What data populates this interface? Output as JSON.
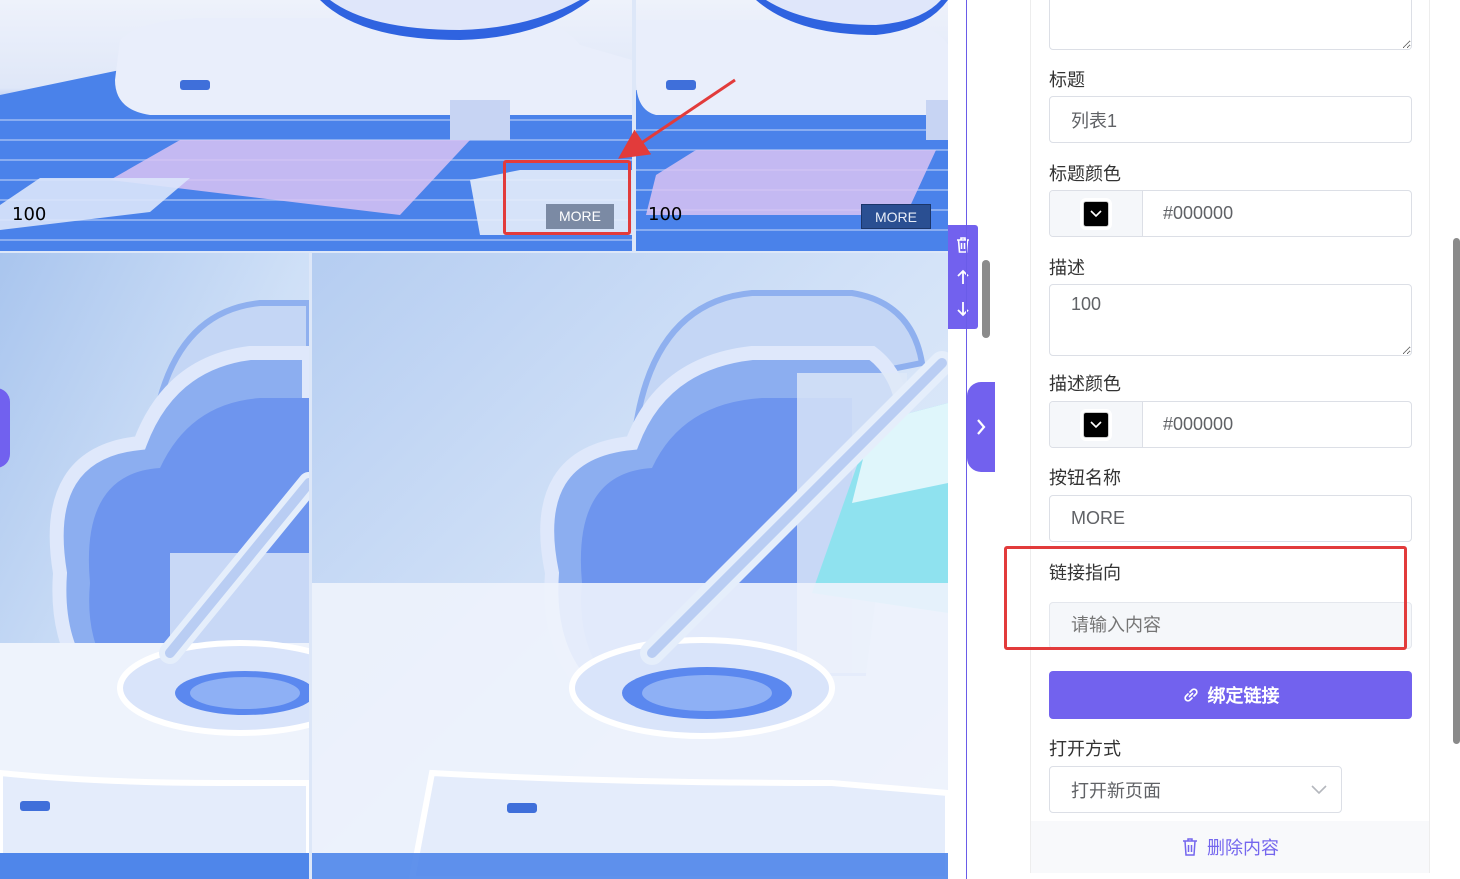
{
  "canvas": {
    "tiles": [
      {
        "desc": "100",
        "button": "MORE"
      },
      {
        "desc": "100",
        "button": "MORE"
      }
    ]
  },
  "toolbar": {
    "icons": [
      "trash-icon",
      "arrow-up-icon",
      "arrow-down-icon"
    ]
  },
  "panel": {
    "title_label": "标题",
    "title_value": "列表1",
    "title_color_label": "标题颜色",
    "title_color_value": "#000000",
    "desc_label": "描述",
    "desc_value": "100",
    "desc_color_label": "描述颜色",
    "desc_color_value": "#000000",
    "button_name_label": "按钮名称",
    "button_name_value": "MORE",
    "link_label": "链接指向",
    "link_placeholder": "请输入内容",
    "bind_link_button": "绑定链接",
    "open_mode_label": "打开方式",
    "open_mode_value": "打开新页面",
    "delete_button": "删除内容"
  },
  "colors": {
    "accent": "#7262ee",
    "annotation": "#e23b3b"
  }
}
